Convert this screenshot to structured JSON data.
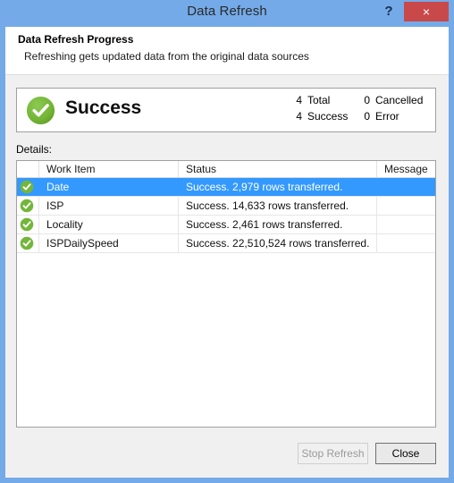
{
  "window": {
    "title": "Data Refresh",
    "help_label": "?",
    "close_label": "×",
    "frame_color": "#74AAE8",
    "close_button_color": "#c9494b"
  },
  "header": {
    "title": "Data Refresh Progress",
    "subtitle": "Refreshing gets updated data from the original data sources"
  },
  "status": {
    "icon": "success-check-icon",
    "label": "Success",
    "color": "#6FB233",
    "counts": [
      {
        "value": "4",
        "label": "Total",
        "value2": "0",
        "label2": "Cancelled"
      },
      {
        "value": "4",
        "label": "Success",
        "value2": "0",
        "label2": "Error"
      }
    ]
  },
  "details": {
    "label": "Details:",
    "columns": [
      "",
      "Work Item",
      "Status",
      "Message"
    ],
    "rows": [
      {
        "icon": "success-check-icon",
        "work_item": "Date",
        "status": "Success. 2,979 rows transferred.",
        "message": "",
        "selected": true
      },
      {
        "icon": "success-check-icon",
        "work_item": "ISP",
        "status": "Success. 14,633 rows transferred.",
        "message": "",
        "selected": false
      },
      {
        "icon": "success-check-icon",
        "work_item": "Locality",
        "status": "Success. 2,461 rows transferred.",
        "message": "",
        "selected": false
      },
      {
        "icon": "success-check-icon",
        "work_item": "ISPDailySpeed",
        "status": "Success. 22,510,524 rows transferred.",
        "message": "",
        "selected": false
      }
    ],
    "selection_color": "#3399FF"
  },
  "buttons": {
    "stop_refresh": "Stop Refresh",
    "close": "Close"
  }
}
